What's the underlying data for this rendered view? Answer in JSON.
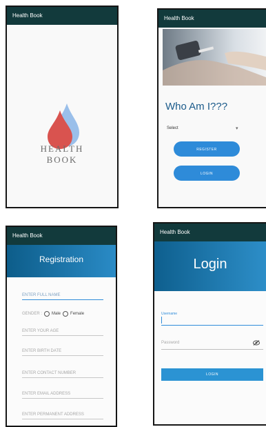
{
  "app_name": "Health Book",
  "splash": {
    "logo_line1": "HEALTH",
    "logo_line2": "BOOK"
  },
  "who_am_i": {
    "title": "Who Am I???",
    "select_label": "Select",
    "caret": "▾",
    "register_label": "REGISTER",
    "login_label": "LOGIN"
  },
  "registration": {
    "title": "Registration",
    "full_name_placeholder": "ENTER FULL NAME",
    "gender_label": "GENDER :",
    "male_label": "Male",
    "female_label": "Female",
    "age_placeholder": "ENTER YOUR AGE",
    "birth_date_placeholder": "ENTER BIRTH DATE",
    "contact_placeholder": "ENTER CONTACT NUMBER",
    "email_placeholder": "ENTER EMAIL ADDRESS",
    "address_placeholder": "ENTER PERMANENT ADDRESS"
  },
  "login": {
    "title": "Login",
    "username_label": "Username",
    "password_placeholder": "Password",
    "login_button": "LOGIN"
  },
  "colors": {
    "toolbar": "#123a3c",
    "accent": "#2e8bd9",
    "header_gradient_start": "#0d5d8a",
    "header_gradient_end": "#2a8bc6",
    "title_blue": "#1a5a8a",
    "drop_red": "#d9534f",
    "drop_blue": "#8fb8e8"
  }
}
